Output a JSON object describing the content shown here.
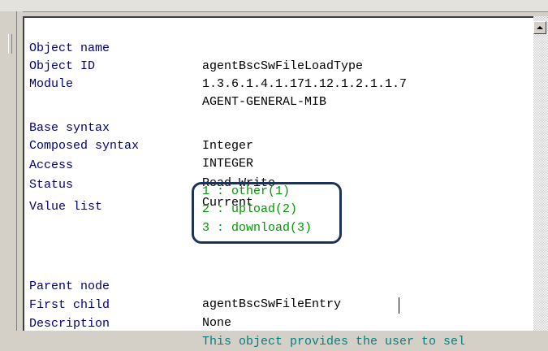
{
  "properties": [
    {
      "label": "Object name",
      "value": "agentBscSwFileLoadType"
    },
    {
      "label": "Object ID",
      "value": "1.3.6.1.4.1.171.12.1.2.1.1.7"
    },
    {
      "label": "Module",
      "value": "AGENT-GENERAL-MIB"
    },
    {
      "label": "Base syntax",
      "value": "Integer"
    },
    {
      "label": "Composed syntax",
      "value": "INTEGER"
    },
    {
      "label": "Access",
      "value": "Read-Write"
    },
    {
      "label": "Status",
      "value": "Current"
    },
    {
      "label": "Value list",
      "value": ""
    },
    {
      "label": "Parent node",
      "value": "agentBscSwFileEntry"
    },
    {
      "label": "First child",
      "value": "None"
    },
    {
      "label": "Description",
      "value": "This object provides the user to sel"
    }
  ],
  "value_list": [
    "1 : other(1)",
    "2 : upload(2)",
    "3 : download(3)"
  ],
  "colors": {
    "label": "#000080",
    "value": "#000000",
    "enum": "#009900",
    "description": "#008080",
    "highlight_border": "#1e3256"
  }
}
